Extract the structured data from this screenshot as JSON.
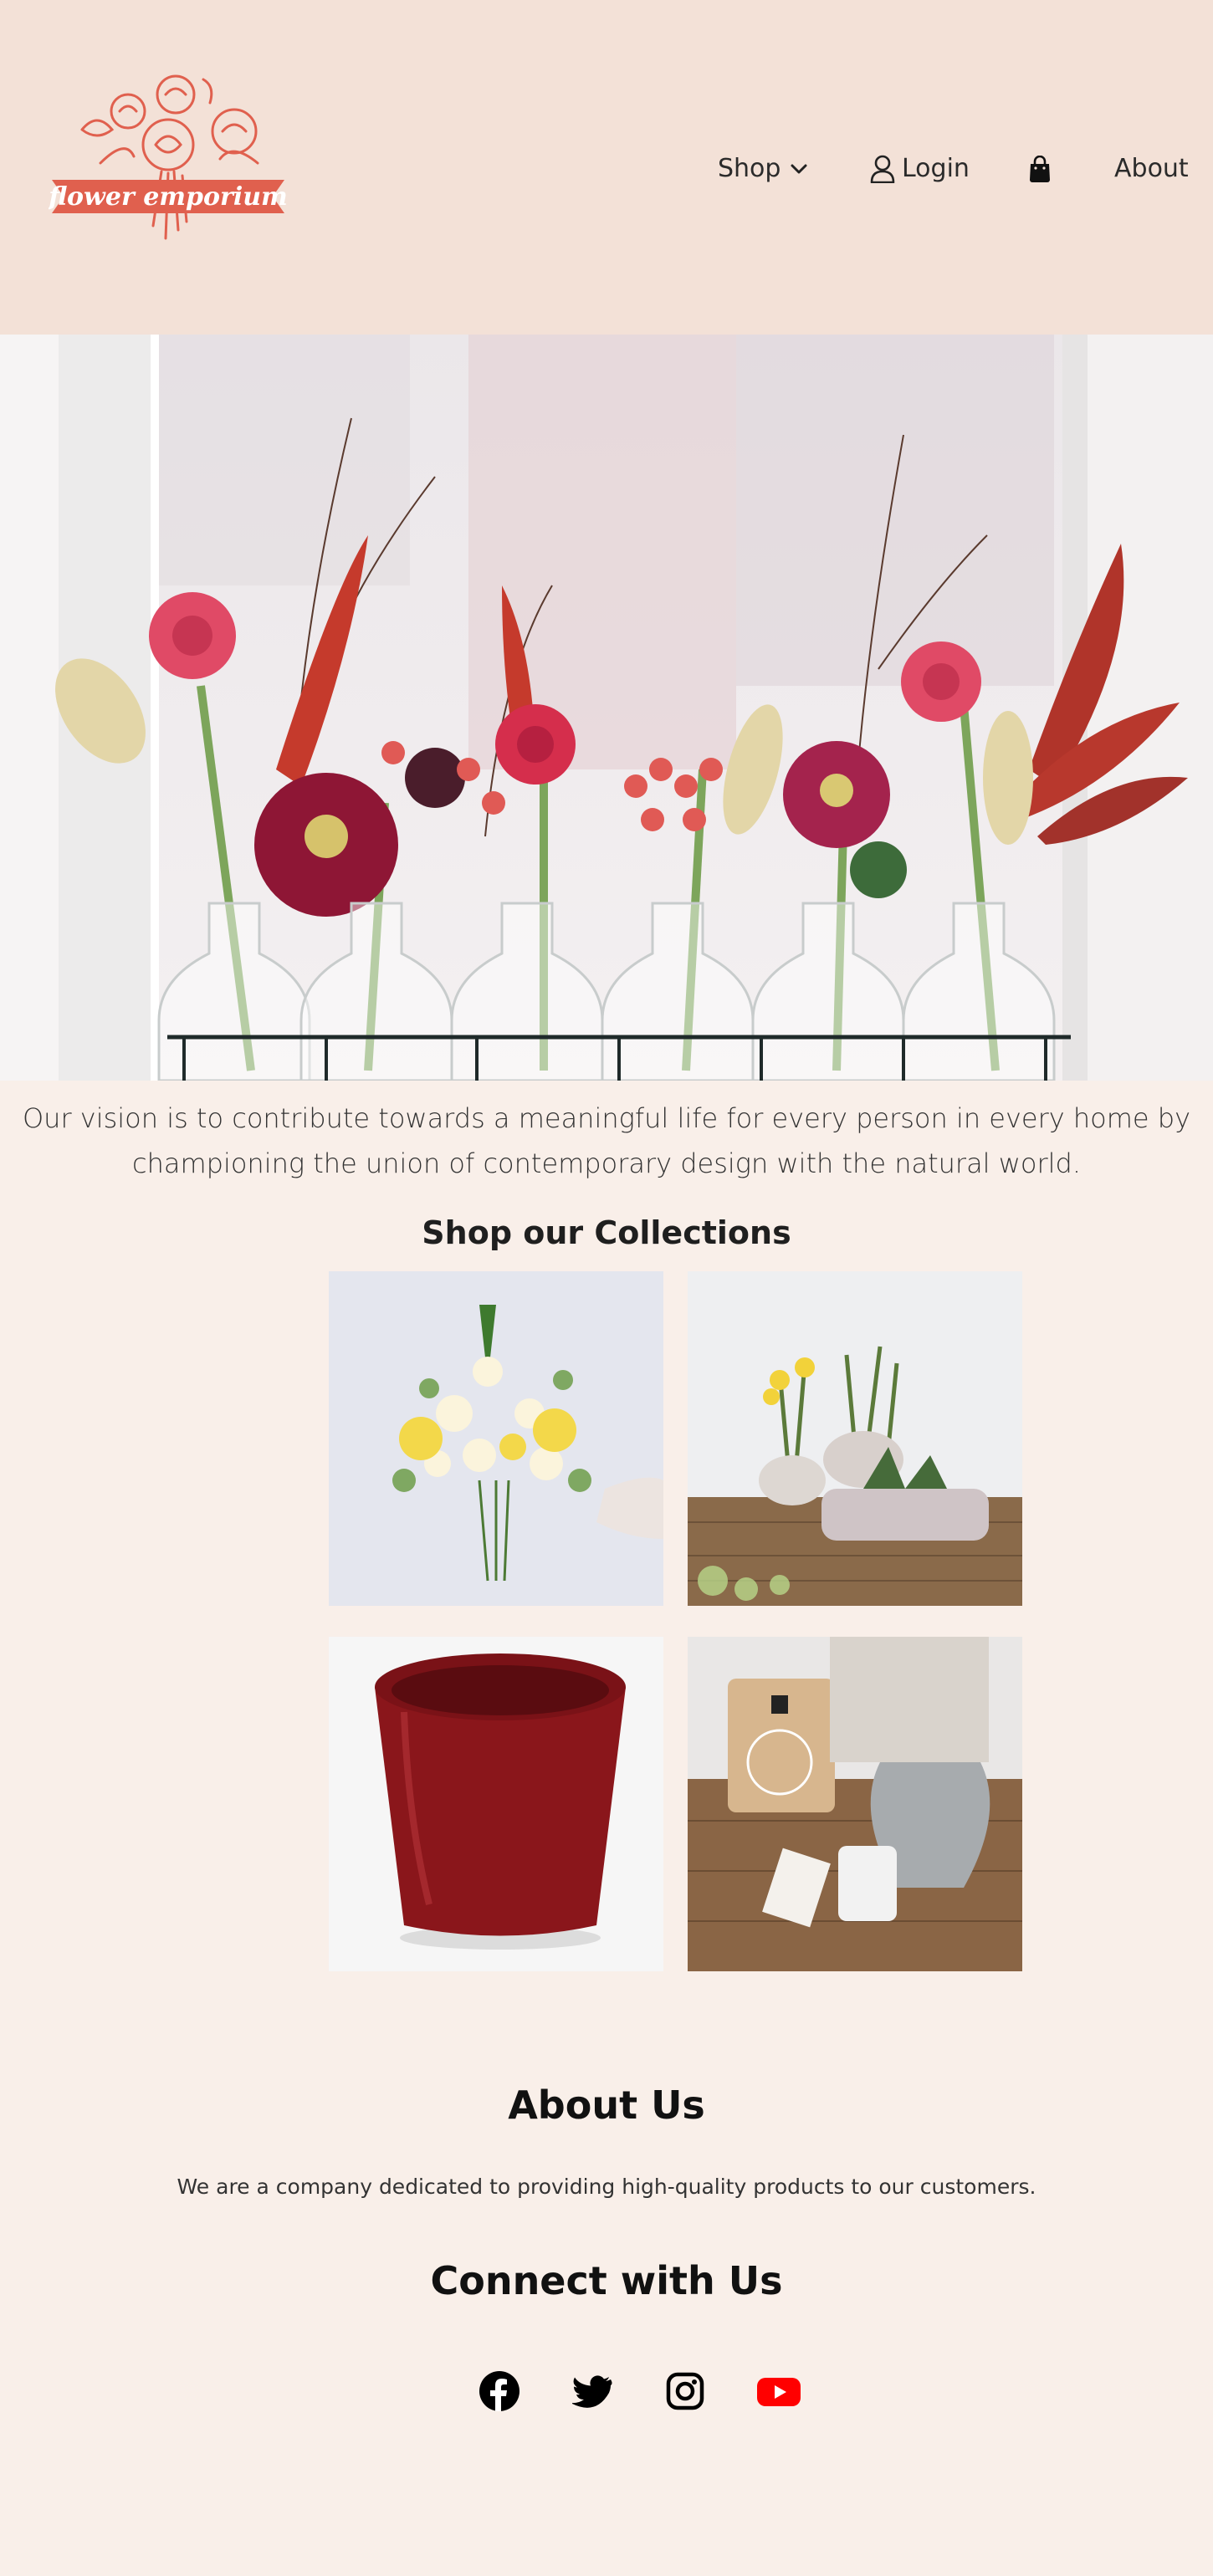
{
  "header": {
    "logo_text": "flower emporium",
    "nav": {
      "shop": "Shop",
      "login": "Login",
      "about": "About"
    }
  },
  "icons": {
    "shop_chevron": "chevron-down-icon",
    "login": "user-icon",
    "cart": "shopping-bag-icon",
    "facebook": "facebook-icon",
    "twitter": "twitter-icon",
    "instagram": "instagram-icon",
    "youtube": "youtube-icon"
  },
  "vision_text": "Our vision is to contribute towards a meaningful life for every person in every home by championing the union of contemporary design with the natural world.",
  "collections": {
    "title": "Shop our Collections"
  },
  "about": {
    "title": "About Us",
    "text": "We are a company dedicated to providing high-quality products to our customers."
  },
  "connect": {
    "title": "Connect with Us"
  },
  "colors": {
    "header_bg": "#f3e1d7",
    "page_bg": "#f9efe9",
    "brand": "#e0604e",
    "youtube": "#ff0000"
  }
}
